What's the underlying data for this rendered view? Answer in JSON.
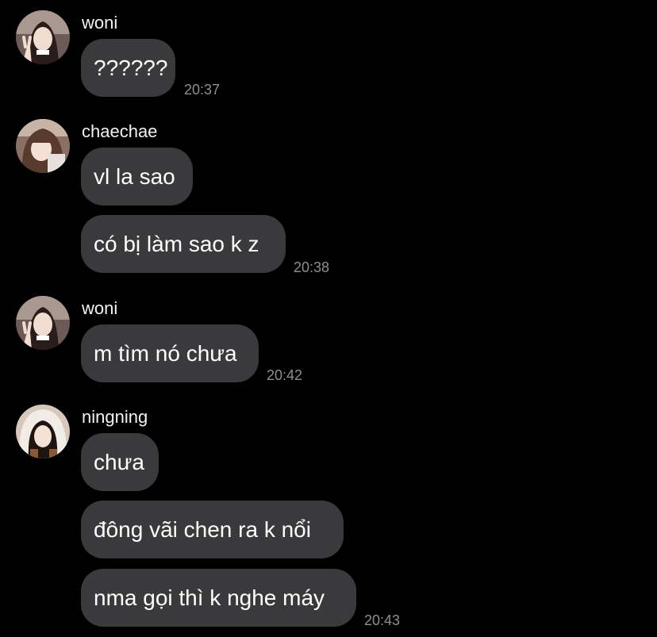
{
  "conversation": {
    "groups": [
      {
        "sender": "woni",
        "avatar_icon": "avatar-woni-photo",
        "messages": [
          "??????"
        ],
        "time": "20:37"
      },
      {
        "sender": "chaechae",
        "avatar_icon": "avatar-chaechae-photo",
        "messages": [
          "vl la sao",
          "có bị làm sao k z"
        ],
        "time": "20:38"
      },
      {
        "sender": "woni",
        "avatar_icon": "avatar-woni-photo",
        "messages": [
          "m tìm nó chưa"
        ],
        "time": "20:42"
      },
      {
        "sender": "ningning",
        "avatar_icon": "avatar-ningning-photo",
        "messages": [
          "chưa",
          "đông vãi chen ra k nổi",
          "nma gọi thì k nghe máy"
        ],
        "time": "20:43"
      }
    ]
  },
  "colors": {
    "background": "#000000",
    "bubble": "#3a3a3c",
    "text": "#ffffff",
    "timestamp": "#8e8e93"
  }
}
